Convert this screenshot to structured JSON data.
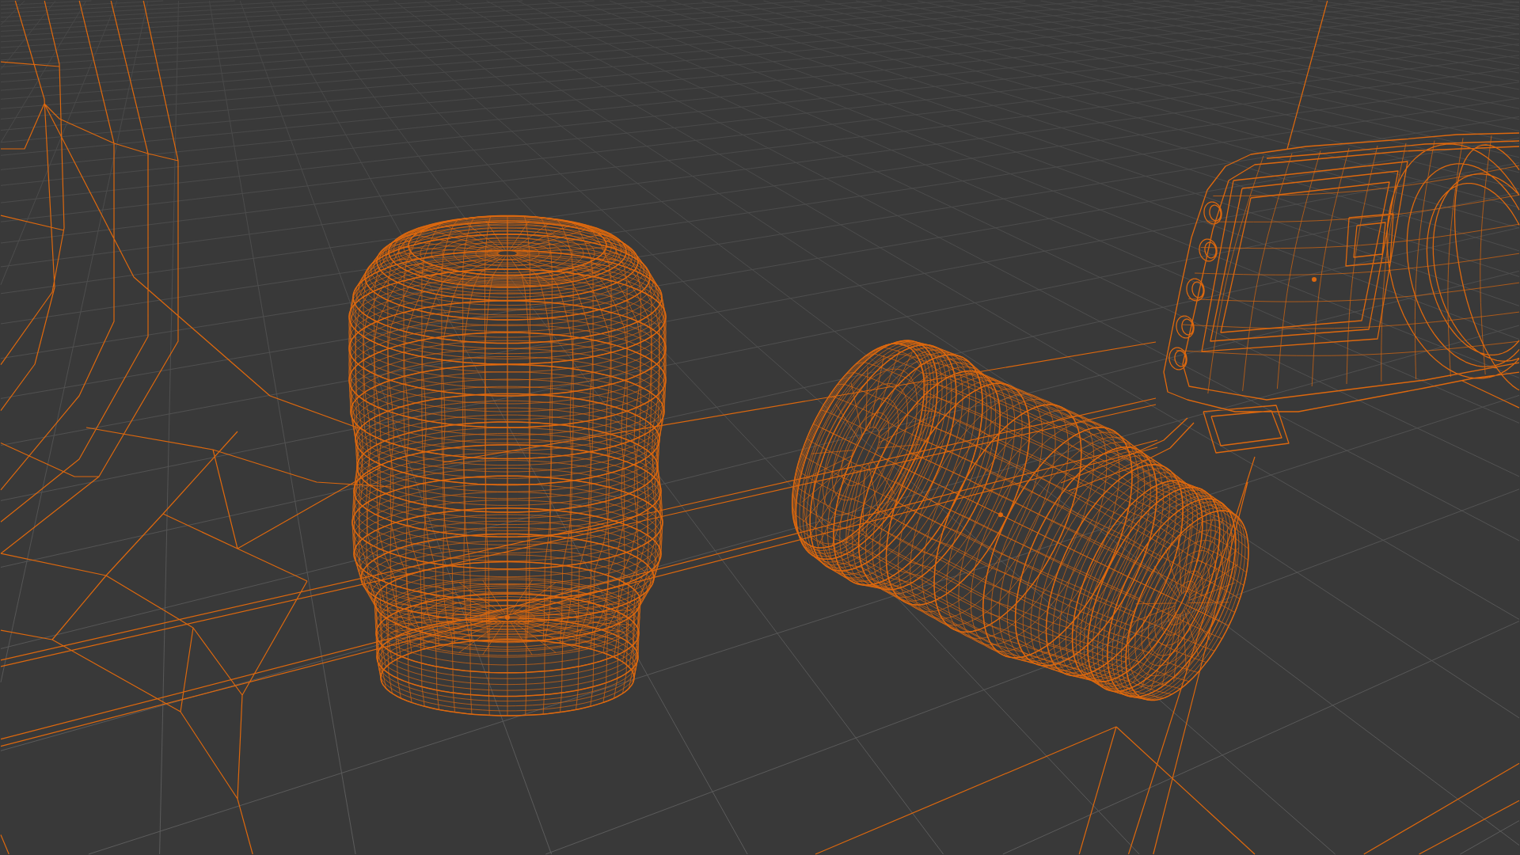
{
  "viewport": {
    "objects": [
      {
        "kind": "backdrop",
        "selected": true
      },
      {
        "kind": "base",
        "selected": true
      },
      {
        "kind": "lens",
        "selected": true
      },
      {
        "kind": "lens",
        "selected": true
      },
      {
        "kind": "camera",
        "selected": true
      }
    ]
  }
}
